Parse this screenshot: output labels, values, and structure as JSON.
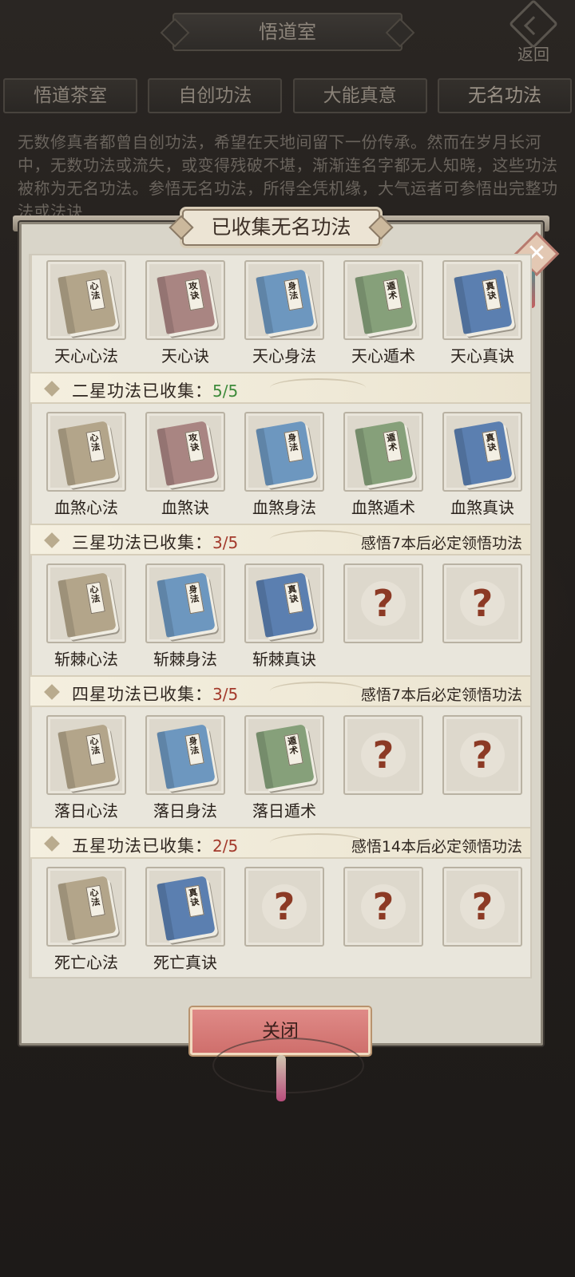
{
  "header": {
    "title": "悟道室",
    "back_label": "返回"
  },
  "tabs": [
    {
      "label": "悟道茶室"
    },
    {
      "label": "自创功法"
    },
    {
      "label": "大能真意"
    },
    {
      "label": "无名功法"
    }
  ],
  "description": "无数修真者都曾自创功法，希望在天地间留下一份传承。然而在岁月长河中，无数功法或流失，或变得残破不堪，渐渐连名字都无人知晓，这些功法被称为无名功法。参悟无名功法，所得全凭机缘，大气运者可参悟出完整功法或法诀",
  "dialog": {
    "title": "已收集无名功法",
    "close_button": "关闭",
    "unknown_mark": "?",
    "sections": [
      {
        "items": [
          {
            "name": "天心心法",
            "tag": "心法",
            "color": "tan"
          },
          {
            "name": "天心诀",
            "tag": "攻诀",
            "color": "rose"
          },
          {
            "name": "天心身法",
            "tag": "身法",
            "color": "blue"
          },
          {
            "name": "天心遁术",
            "tag": "遁术",
            "color": "green"
          },
          {
            "name": "天心真诀",
            "tag": "真诀",
            "color": "navy"
          }
        ]
      },
      {
        "label": "二星功法已收集：",
        "count": "5/5",
        "count_color": "green",
        "hint": "",
        "items": [
          {
            "name": "血煞心法",
            "tag": "心法",
            "color": "tan"
          },
          {
            "name": "血煞诀",
            "tag": "攻诀",
            "color": "rose"
          },
          {
            "name": "血煞身法",
            "tag": "身法",
            "color": "blue"
          },
          {
            "name": "血煞遁术",
            "tag": "遁术",
            "color": "green"
          },
          {
            "name": "血煞真诀",
            "tag": "真诀",
            "color": "navy"
          }
        ]
      },
      {
        "label": "三星功法已收集：",
        "count": "3/5",
        "count_color": "red",
        "hint": "感悟7本后必定领悟功法",
        "items": [
          {
            "name": "斩棘心法",
            "tag": "心法",
            "color": "tan"
          },
          {
            "name": "斩棘身法",
            "tag": "身法",
            "color": "blue"
          },
          {
            "name": "斩棘真诀",
            "tag": "真诀",
            "color": "navy"
          },
          {
            "name": "",
            "unknown": true
          },
          {
            "name": "",
            "unknown": true
          }
        ]
      },
      {
        "label": "四星功法已收集：",
        "count": "3/5",
        "count_color": "red",
        "hint": "感悟7本后必定领悟功法",
        "items": [
          {
            "name": "落日心法",
            "tag": "心法",
            "color": "tan"
          },
          {
            "name": "落日身法",
            "tag": "身法",
            "color": "blue"
          },
          {
            "name": "落日遁术",
            "tag": "遁术",
            "color": "green"
          },
          {
            "name": "",
            "unknown": true
          },
          {
            "name": "",
            "unknown": true
          }
        ]
      },
      {
        "label": "五星功法已收集：",
        "count": "2/5",
        "count_color": "red",
        "hint": "感悟14本后必定领悟功法",
        "items": [
          {
            "name": "死亡心法",
            "tag": "心法",
            "color": "tan"
          },
          {
            "name": "死亡真诀",
            "tag": "真诀",
            "color": "navy"
          },
          {
            "name": "",
            "unknown": true
          },
          {
            "name": "",
            "unknown": true
          },
          {
            "name": "",
            "unknown": true
          }
        ]
      }
    ]
  }
}
